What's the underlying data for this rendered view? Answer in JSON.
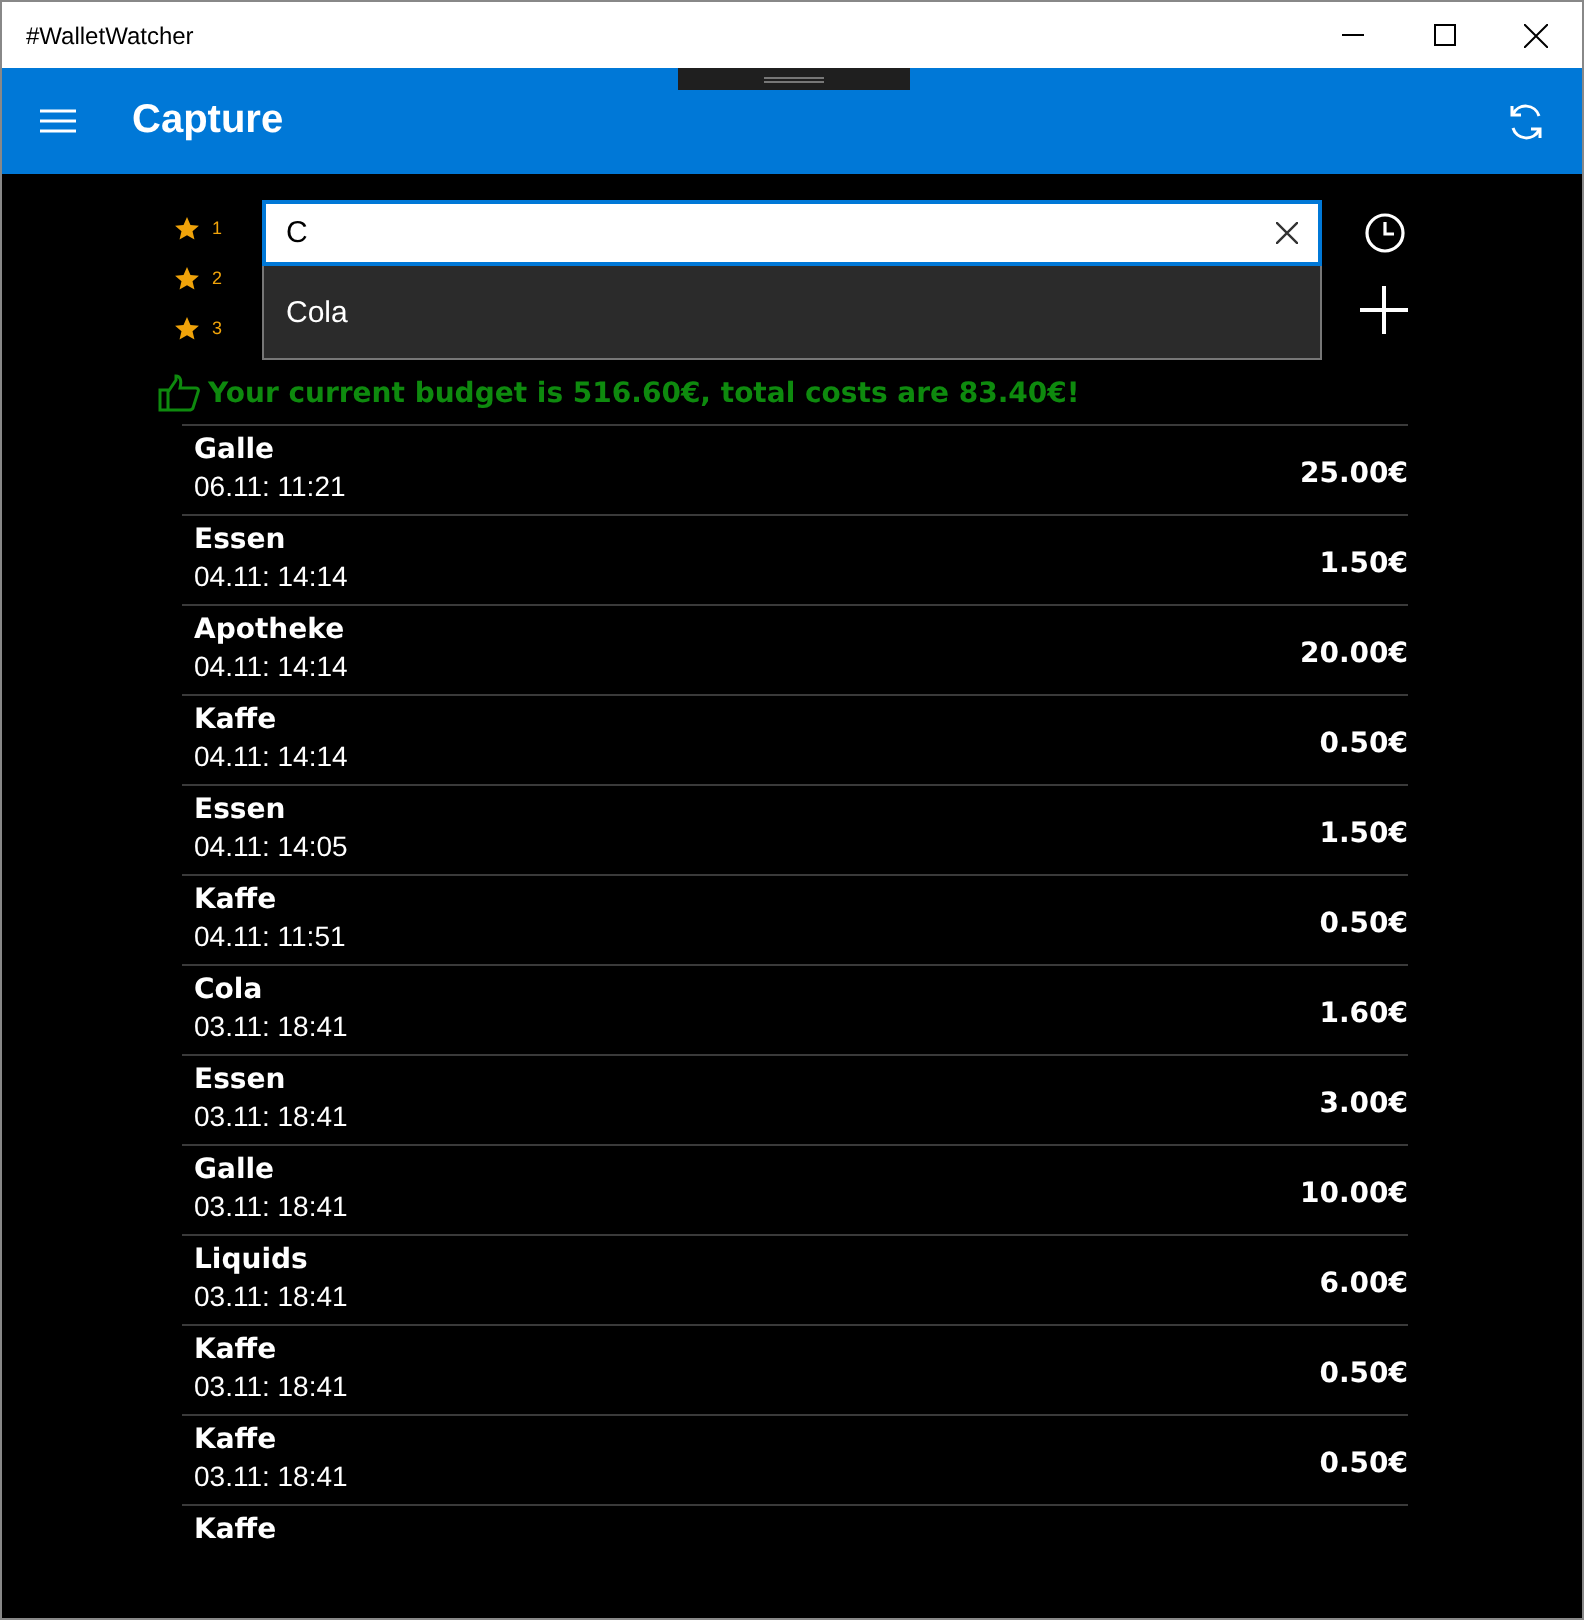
{
  "window": {
    "title": "#WalletWatcher"
  },
  "header": {
    "title": "Capture"
  },
  "quick_slots": [
    "1",
    "2",
    "3"
  ],
  "search": {
    "value": "C",
    "suggestions": [
      "Cola"
    ]
  },
  "budget_message": "Your current budget is 516.60€, total costs are 83.40€!",
  "expenses": [
    {
      "name": "Galle",
      "date": "06.11: 11:21",
      "amount": "25.00€"
    },
    {
      "name": "Essen",
      "date": "04.11: 14:14",
      "amount": "1.50€"
    },
    {
      "name": "Apotheke",
      "date": "04.11: 14:14",
      "amount": "20.00€"
    },
    {
      "name": "Kaffe",
      "date": "04.11: 14:14",
      "amount": "0.50€"
    },
    {
      "name": "Essen",
      "date": "04.11: 14:05",
      "amount": "1.50€"
    },
    {
      "name": "Kaffe",
      "date": "04.11: 11:51",
      "amount": "0.50€"
    },
    {
      "name": "Cola",
      "date": "03.11: 18:41",
      "amount": "1.60€"
    },
    {
      "name": "Essen",
      "date": "03.11: 18:41",
      "amount": "3.00€"
    },
    {
      "name": "Galle",
      "date": "03.11: 18:41",
      "amount": "10.00€"
    },
    {
      "name": "Liquids",
      "date": "03.11: 18:41",
      "amount": "6.00€"
    },
    {
      "name": "Kaffe",
      "date": "03.11: 18:41",
      "amount": "0.50€"
    },
    {
      "name": "Kaffe",
      "date": "03.11: 18:41",
      "amount": "0.50€"
    },
    {
      "name": "Kaffe"
    }
  ]
}
